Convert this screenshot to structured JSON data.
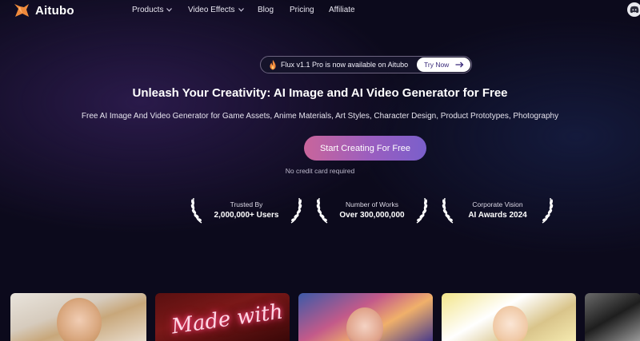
{
  "brand": {
    "name": "Aitubo",
    "logo_icon": "fox-logo-icon",
    "accent": "#f08a3c"
  },
  "nav": {
    "items": [
      {
        "label": "Products",
        "dropdown": true
      },
      {
        "label": "Video Effects",
        "dropdown": true
      },
      {
        "label": "Blog",
        "dropdown": false
      },
      {
        "label": "Pricing",
        "dropdown": false
      },
      {
        "label": "Affiliate",
        "dropdown": false
      }
    ],
    "discord_icon": "discord-icon"
  },
  "announcement": {
    "text": "Flux v1.1 Pro is now available on Aitubo",
    "button": "Try Now",
    "icon": "flame-icon"
  },
  "hero": {
    "headline": "Unleash Your Creativity: AI Image and AI Video Generator for Free",
    "subline": "Free AI Image And Video Generator for Game Assets, Anime Materials, Art Styles, Character Design, Product Prototypes, Photography",
    "cta": "Start Creating For Free",
    "cta_note": "No credit card required",
    "cta_colors": [
      "#c9659b",
      "#7a5fcb"
    ]
  },
  "stats": [
    {
      "label": "Trusted By",
      "value": "2,000,000+ Users"
    },
    {
      "label": "Number of Works",
      "value": "Over 300,000,000"
    },
    {
      "label": "Corporate Vision",
      "value": "AI Awards 2024"
    }
  ],
  "gallery": {
    "neon_text": "Made with"
  }
}
